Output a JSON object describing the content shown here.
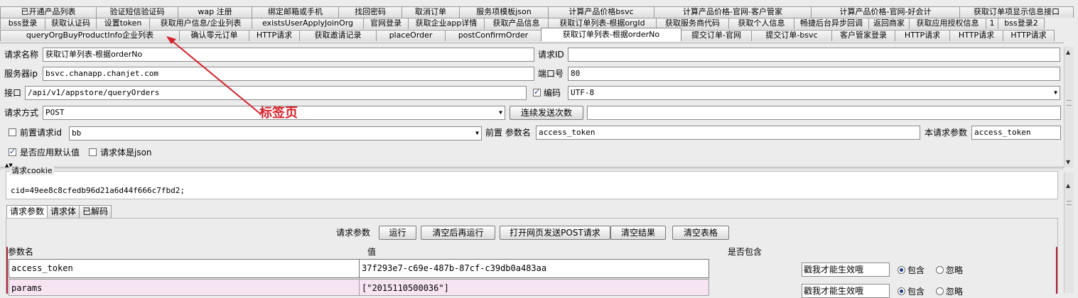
{
  "tabs": {
    "row1": [
      "已开通产品列表",
      "验证短信验证码",
      "wap 注册",
      "绑定邮箱或手机",
      "找回密码",
      "取消订单",
      "服务项模板json",
      "计算产品价格bsvc",
      "计算产品价格-官网-客户管家",
      "计算产品价格-官网-好会计",
      "获取订单项显示信息接口"
    ],
    "row2": [
      "bss登录",
      "获取认证码",
      "设置token",
      "获取用户信息/企业列表",
      "existsUserApplyJoinOrg",
      "官网登录",
      "获取企业app详情",
      "获取产品信息",
      "获取订单列表-根据orgId",
      "获取服务商代码",
      "获取个人信息",
      "畅捷后台异步回调",
      "返回商家",
      "获取应用授权信息",
      "1",
      "bss登录2"
    ],
    "row3": [
      "queryOrgBuyProductInfo企业列表",
      "确认零元订单",
      "HTTP请求",
      "获取邀请记录",
      "placeOrder",
      "postConfirmOrder",
      "获取订单列表-根据orderNo",
      "提交订单-官网",
      "提交订单-bsvc",
      "客户管家登录",
      "HTTP请求",
      "HTTP请求",
      "HTTP请求"
    ]
  },
  "form": {
    "name_label": "请求名称",
    "name_value": "获取订单列表-根据orderNo",
    "id_label": "请求ID",
    "id_value": "",
    "ip_label": "服务器ip",
    "ip_value": "bsvc.chanapp.chanjet.com",
    "port_label": "端口号",
    "port_value": "80",
    "path_label": "接口",
    "path_value": "/api/v1/appstore/queryOrders",
    "encoding_label": "编码",
    "encoding_value": "UTF-8",
    "method_label": "请求方式",
    "method_value": "POST",
    "send_count_button": "连续发送次数",
    "send_count_value": "",
    "pre_request_label": "前置请求id",
    "pre_request_value": "bb",
    "pre_param_label": "前置 参数名",
    "pre_param_value": "access_token",
    "this_param_label": "本请求参数",
    "this_param_value": "access_token",
    "default_label": "是否应用默认值",
    "json_label": "请求体是json"
  },
  "annotation": {
    "text": "标签页",
    "color": "#d8202a"
  },
  "cookie": {
    "legend": "请求cookie",
    "value": "cid=49ee8c8cfedb96d21a6d44f666c7fbd2;"
  },
  "subtabs": [
    "请求参数",
    "请求体",
    "已解码"
  ],
  "toolbar": {
    "label": "请求参数",
    "run": "运行",
    "clear_run": "清空后再运行",
    "open_post": "打开网页发送POST请求",
    "clear_result": "清空结果",
    "clear_table": "清空表格"
  },
  "table": {
    "headers": [
      "参数名",
      "值",
      "是否包含"
    ],
    "rows": [
      {
        "name": "access_token",
        "value": "37f293e7-c69e-487b-87cf-c39db0a483aa",
        "hint": "戳我才能生效哦",
        "include": "包含",
        "ignore": "忽略"
      },
      {
        "name": "params",
        "value": "[\"2015110500036\"]",
        "hint": "戳我才能生效哦",
        "include": "包含",
        "ignore": "忽略"
      }
    ]
  }
}
